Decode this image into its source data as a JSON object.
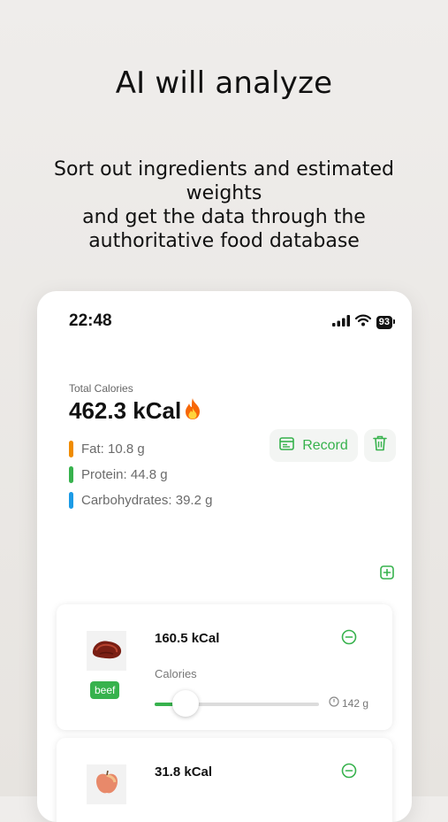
{
  "promo": {
    "headline": "AI will analyze",
    "subtitle_lines": [
      "Sort out ingredients and estimated",
      "weights",
      "and get the data through the",
      "authoritative food database"
    ]
  },
  "status_bar": {
    "time": "22:48",
    "battery": "93",
    "icons": [
      "signal-icon",
      "wifi-icon",
      "battery-icon"
    ]
  },
  "summary": {
    "total_label": "Total Calories",
    "total_value": "462.3 kCal",
    "macros": [
      {
        "label": "Fat: 10.8 g",
        "color": "#f08c00"
      },
      {
        "label": "Protein: 44.8 g",
        "color": "#37b24d"
      },
      {
        "label": "Carbohydrates: 39.2 g",
        "color": "#1c9be6"
      }
    ],
    "record_label": "Record"
  },
  "colors": {
    "accent": "#37b24d",
    "record_bg": "#f3f5f3"
  },
  "foods": [
    {
      "kcal": "160.5 kCal",
      "tag": "beef",
      "calories_label": "Calories",
      "weight": "142 g",
      "slider_fraction": 0.19,
      "icon": "beef-icon"
    },
    {
      "kcal": "31.8 kCal",
      "icon": "apple-icon"
    }
  ]
}
